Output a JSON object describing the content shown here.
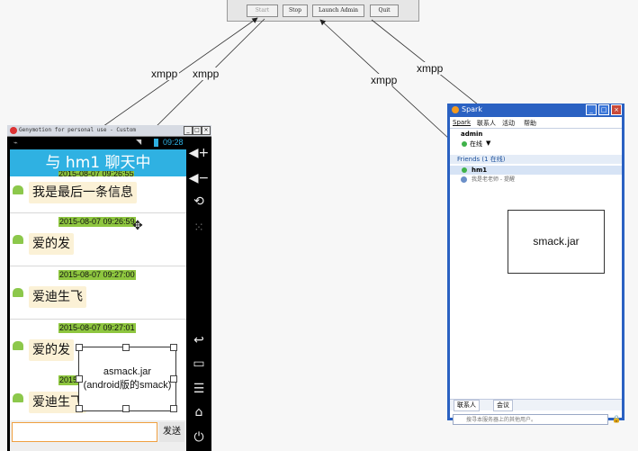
{
  "server": {
    "buttons": [
      "Start",
      "Stop",
      "Launch Admin",
      "Quit"
    ]
  },
  "connections": {
    "label": "xmpp"
  },
  "emulator": {
    "window_title": "Genymotion for personal use - Custom",
    "status_time": "09:28",
    "chat_header": "与 hm1 聊天中",
    "top_timestamp_partial": "2015-08-07 09:26:55",
    "messages": [
      {
        "timestamp": "",
        "text": "我是最后一条信息"
      },
      {
        "timestamp": "2015-08-07 09:26:59",
        "text": "爱的发"
      },
      {
        "timestamp": "2015-08-07 09:27:00",
        "text": "爱迪生飞"
      },
      {
        "timestamp": "2015-08-07 09:27:01",
        "text": "爱的发"
      },
      {
        "timestamp": "2015",
        "text": "爱迪生飞"
      }
    ],
    "send_label": "发送"
  },
  "asmack_box": {
    "line1": "asmack.jar",
    "line2": "(android版的smack)"
  },
  "spark": {
    "title": "Spark",
    "menu": [
      "Spark",
      "联系人",
      "活动",
      "帮助"
    ],
    "user": "admin",
    "presence": "在线",
    "group_header": "Friends (1 在线)",
    "contacts": [
      "hm1",
      "我是老老师 - 提醒"
    ],
    "tabs": [
      "联系人",
      "会议"
    ],
    "search_placeholder": "搜寻本服务器上的其他用户。"
  },
  "smack_box": {
    "label": "smack.jar"
  },
  "colors": {
    "chat_header": "#2fb1e2",
    "timestamp_bg": "#8ec63f",
    "bubble_bg": "#fbf1d6",
    "spark_frame": "#2a61c2"
  }
}
